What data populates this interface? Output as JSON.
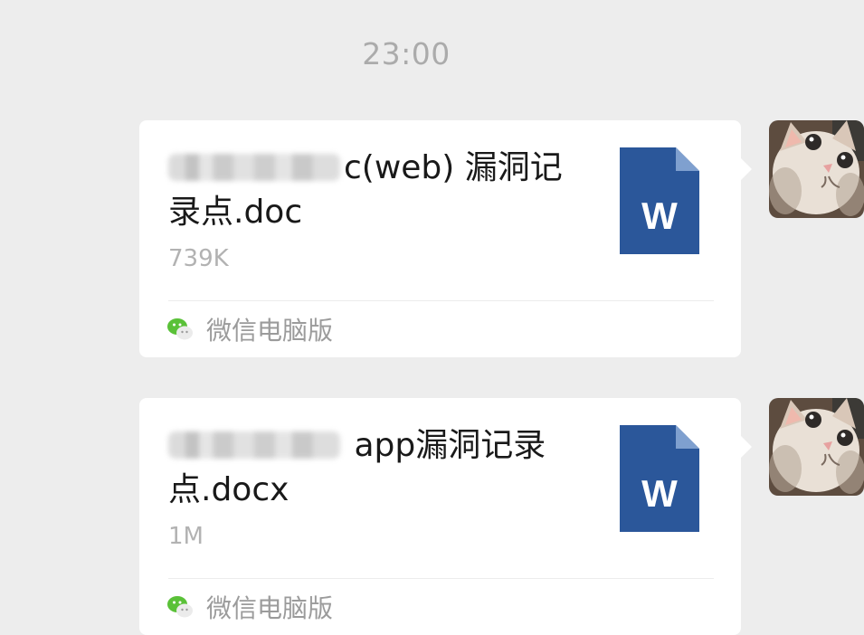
{
  "chat": {
    "timestamp": "23:00"
  },
  "messages": [
    {
      "filename_visible": "c(web) 漏洞记录点.doc",
      "file_size": "739K",
      "file_type_icon": "word-document-icon",
      "file_icon_letter": "W",
      "source_label": "微信电脑版"
    },
    {
      "filename_visible": " app漏洞记录点.docx",
      "file_size": "1M",
      "file_type_icon": "word-document-icon",
      "file_icon_letter": "W",
      "source_label": "微信电脑版"
    }
  ],
  "colors": {
    "background": "#ededed",
    "card": "#ffffff",
    "word_blue": "#2b579a",
    "wechat_green": "#5ac138",
    "timestamp_gray": "#ababab",
    "meta_gray": "#b2b2b2"
  }
}
